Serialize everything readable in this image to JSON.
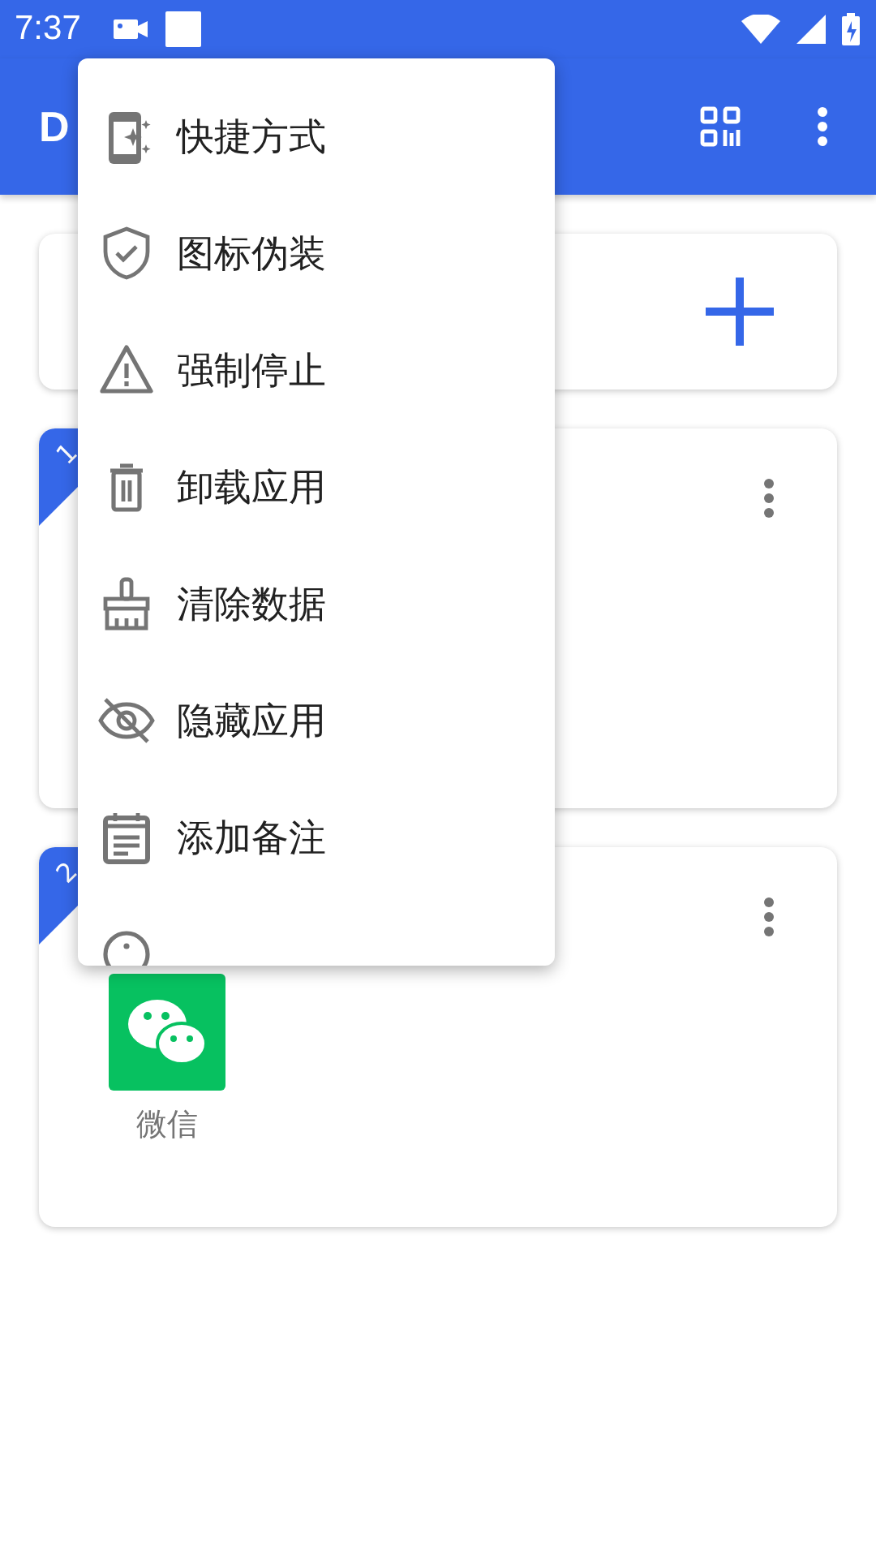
{
  "status_bar": {
    "time": "7:37"
  },
  "app_bar": {
    "title": "D"
  },
  "menu": {
    "items": [
      {
        "kind": "shortcut",
        "label": "快捷方式"
      },
      {
        "kind": "shield",
        "label": "图标伪装"
      },
      {
        "kind": "warning",
        "label": "强制停止"
      },
      {
        "kind": "trash",
        "label": "卸载应用"
      },
      {
        "kind": "brush",
        "label": "清除数据"
      },
      {
        "kind": "eye-off",
        "label": "隐藏应用"
      },
      {
        "kind": "note",
        "label": "添加备注"
      },
      {
        "kind": "copy"
      }
    ]
  },
  "cards": [
    {
      "kind": "add"
    },
    {
      "kind": "space",
      "badge": "1"
    },
    {
      "kind": "space",
      "badge": "2",
      "apps": [
        {
          "name": "微信"
        }
      ]
    }
  ]
}
